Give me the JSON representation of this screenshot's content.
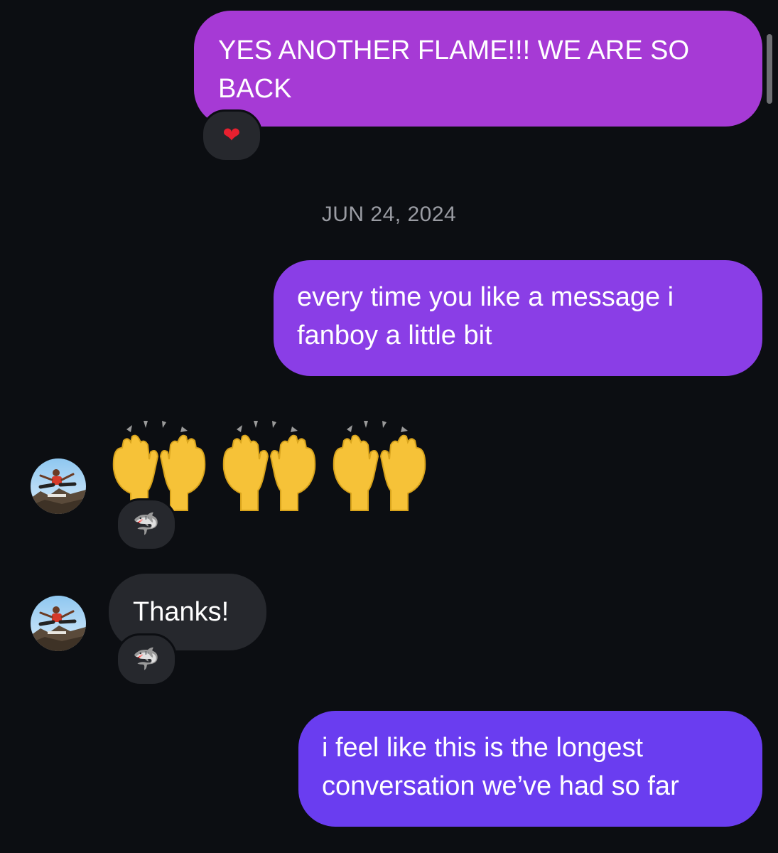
{
  "colors": {
    "background": "#0c0e12",
    "received_bubble": "#26282d",
    "date_text": "#9a9ca3",
    "sent_gradient_top": "#a63ad5",
    "sent_gradient_mid": "#8a3ee6",
    "sent_gradient_bottom": "#6a3df0"
  },
  "messages": [
    {
      "direction": "sent",
      "text": "YES ANOTHER FLAME!!! WE ARE SO BACK",
      "reaction": {
        "icon": "red-heart-icon",
        "glyph": "❤"
      }
    },
    {
      "type": "date-separator",
      "text": "JUN 24, 2024"
    },
    {
      "direction": "sent",
      "text": "every time you like a message i fanboy a little bit"
    },
    {
      "direction": "received",
      "type": "emoji",
      "text": "🙌🙌🙌",
      "avatar": "profile-avatar",
      "reaction": {
        "icon": "shark-icon",
        "glyph": "🦈"
      }
    },
    {
      "direction": "received",
      "text": "Thanks!",
      "avatar": "profile-avatar",
      "reaction": {
        "icon": "shark-icon",
        "glyph": "🦈"
      }
    },
    {
      "direction": "sent",
      "text": "i feel like this is the longest conversation we’ve had so far"
    }
  ]
}
